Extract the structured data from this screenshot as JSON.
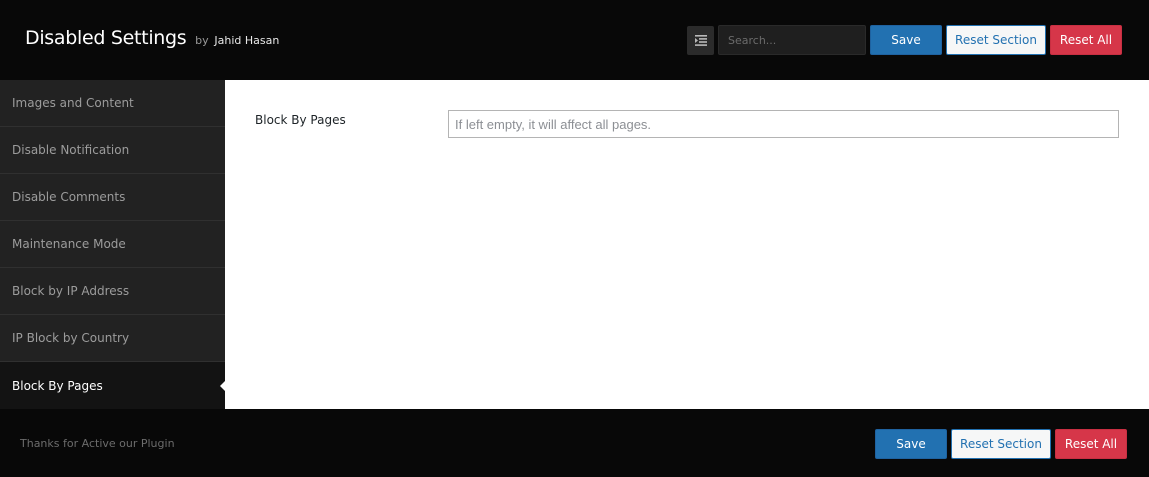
{
  "header": {
    "title": "Disabled Settings",
    "by": "by",
    "author": "Jahid Hasan",
    "search_placeholder": "Search...",
    "save_label": "Save",
    "reset_section_label": "Reset Section",
    "reset_all_label": "Reset All"
  },
  "sidebar": {
    "items": [
      {
        "label": "Images and Content"
      },
      {
        "label": "Disable Notification"
      },
      {
        "label": "Disable Comments"
      },
      {
        "label": "Maintenance Mode"
      },
      {
        "label": "Block by IP Address"
      },
      {
        "label": "IP Block by Country"
      },
      {
        "label": "Block By Pages"
      }
    ],
    "active_item": "Block By Pages"
  },
  "main": {
    "field": {
      "label": "Block By Pages",
      "value": "",
      "placeholder": "If left empty, it will affect all pages."
    }
  },
  "footer": {
    "text": "Thanks for Active our Plugin",
    "save_label": "Save",
    "reset_section_label": "Reset Section",
    "reset_all_label": "Reset All"
  },
  "colors": {
    "primary": "#2271b1",
    "danger": "#d63649",
    "header_bg": "#080808",
    "sidebar_bg": "#222222"
  },
  "icons": {
    "expand": "expand-toggle-icon"
  }
}
